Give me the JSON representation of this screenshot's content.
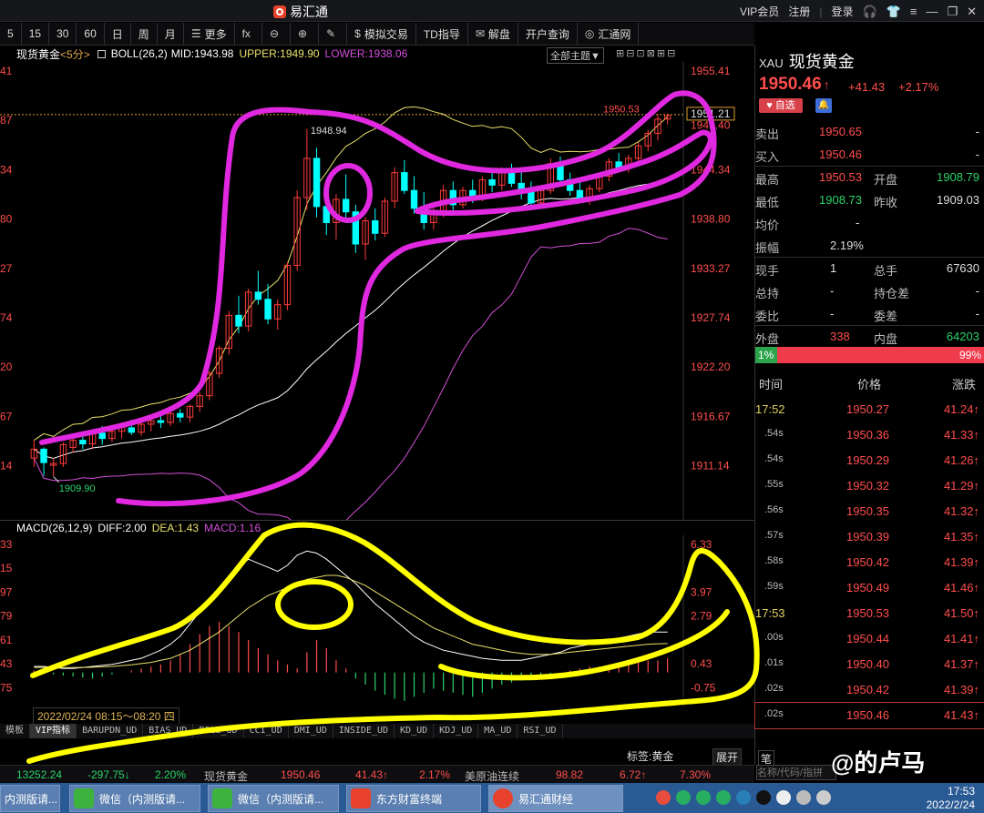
{
  "window": {
    "title": "易汇通",
    "right_links": [
      "VIP会员",
      "注册",
      "登录"
    ]
  },
  "toolbar": {
    "items": [
      {
        "label": "5"
      },
      {
        "label": "15"
      },
      {
        "label": "30"
      },
      {
        "label": "60"
      },
      {
        "label": "日"
      },
      {
        "label": "周"
      },
      {
        "label": "月"
      },
      {
        "label": "更多",
        "icon": "☰"
      },
      {
        "label": "",
        "icon": "fx"
      },
      {
        "label": "",
        "icon": "⊖"
      },
      {
        "label": "",
        "icon": "⊕"
      },
      {
        "label": "",
        "icon": "✎"
      },
      {
        "label": "模拟交易",
        "icon": "$"
      },
      {
        "label": "TD指导"
      },
      {
        "label": "解盘",
        "icon": "✉"
      },
      {
        "label": "开户查询"
      },
      {
        "label": "汇通网",
        "icon": "◎"
      }
    ]
  },
  "chart": {
    "symbol_label": "现货黄金",
    "period": "<5分>",
    "boll_label": "BOLL(26,2)",
    "mid": "MID:1943.98",
    "upper": "UPPER:1949.90",
    "lower": "LOWER:1938.06",
    "theme_select": "全部主题▼",
    "left_ticks": [
      "41",
      "87",
      "34",
      "80",
      "27",
      "74",
      "20",
      "67",
      "14"
    ],
    "right_ticks": [
      "1955.41",
      "1938.80",
      "1933.27",
      "1927.74",
      "1922.20",
      "1916.67",
      "1911.14"
    ],
    "current_tag": "1951.21",
    "high_label": "1950.53",
    "peak_label": "1948.94",
    "low_label": "1909.90",
    "price_tick_1944": "1944.34",
    "price_tick_1949": "1949.40"
  },
  "chart_data": {
    "type": "candlestick",
    "title": "现货黄金 5分",
    "ylim": [
      1906.0,
      1956.0
    ],
    "candles": [
      [
        1912.0,
        1914.0,
        1911.0,
        1913.0
      ],
      [
        1913.0,
        1913.2,
        1910.0,
        1911.5
      ],
      [
        1911.2,
        1912.0,
        1909.9,
        1911.4
      ],
      [
        1911.4,
        1913.8,
        1911.0,
        1913.5
      ],
      [
        1913.2,
        1914.4,
        1912.6,
        1914.0
      ],
      [
        1914.0,
        1914.6,
        1913.0,
        1913.6
      ],
      [
        1913.6,
        1915.2,
        1913.0,
        1915.0
      ],
      [
        1914.8,
        1915.6,
        1913.5,
        1914.2
      ],
      [
        1914.2,
        1915.4,
        1913.8,
        1915.0
      ],
      [
        1915.0,
        1916.0,
        1914.2,
        1915.6
      ],
      [
        1915.4,
        1916.3,
        1914.6,
        1914.9
      ],
      [
        1914.9,
        1916.0,
        1914.5,
        1915.8
      ],
      [
        1915.8,
        1916.6,
        1915.0,
        1916.2
      ],
      [
        1916.2,
        1917.0,
        1915.4,
        1916.0
      ],
      [
        1916.0,
        1917.2,
        1915.6,
        1917.0
      ],
      [
        1917.0,
        1917.5,
        1916.0,
        1916.6
      ],
      [
        1916.6,
        1918.0,
        1916.0,
        1917.8
      ],
      [
        1917.8,
        1919.4,
        1917.2,
        1919.0
      ],
      [
        1919.0,
        1921.8,
        1918.5,
        1921.5
      ],
      [
        1921.5,
        1924.6,
        1921.0,
        1924.3
      ],
      [
        1924.3,
        1928.5,
        1923.6,
        1928.0
      ],
      [
        1928.0,
        1930.2,
        1926.0,
        1926.8
      ],
      [
        1926.8,
        1931.0,
        1926.2,
        1930.6
      ],
      [
        1930.6,
        1933.0,
        1929.2,
        1929.8
      ],
      [
        1929.8,
        1931.5,
        1927.0,
        1927.6
      ],
      [
        1927.6,
        1929.8,
        1926.4,
        1929.2
      ],
      [
        1929.2,
        1934.0,
        1928.6,
        1933.6
      ],
      [
        1933.6,
        1942.0,
        1933.0,
        1941.2
      ],
      [
        1941.2,
        1948.9,
        1939.8,
        1945.6
      ],
      [
        1945.6,
        1946.8,
        1939.0,
        1940.2
      ],
      [
        1940.2,
        1942.6,
        1937.0,
        1938.4
      ],
      [
        1938.4,
        1941.6,
        1936.5,
        1941.0
      ],
      [
        1941.0,
        1943.8,
        1938.6,
        1939.6
      ],
      [
        1939.6,
        1940.4,
        1935.0,
        1936.0
      ],
      [
        1936.0,
        1939.0,
        1934.2,
        1938.6
      ],
      [
        1938.6,
        1940.0,
        1936.4,
        1937.2
      ],
      [
        1937.2,
        1941.2,
        1936.8,
        1940.8
      ],
      [
        1940.8,
        1944.6,
        1940.0,
        1944.0
      ],
      [
        1944.0,
        1945.4,
        1941.6,
        1942.0
      ],
      [
        1942.0,
        1943.6,
        1939.4,
        1940.0
      ],
      [
        1940.0,
        1941.8,
        1937.6,
        1938.4
      ],
      [
        1938.4,
        1940.0,
        1937.6,
        1939.6
      ],
      [
        1939.6,
        1942.6,
        1939.0,
        1942.0
      ],
      [
        1942.0,
        1943.0,
        1939.6,
        1940.4
      ],
      [
        1940.4,
        1942.4,
        1940.0,
        1942.0
      ],
      [
        1942.0,
        1943.2,
        1940.6,
        1941.2
      ],
      [
        1941.2,
        1943.6,
        1940.8,
        1943.2
      ],
      [
        1943.2,
        1944.2,
        1941.8,
        1942.6
      ],
      [
        1942.6,
        1944.6,
        1942.0,
        1944.0
      ],
      [
        1944.0,
        1945.0,
        1942.4,
        1942.8
      ],
      [
        1942.8,
        1944.0,
        1941.0,
        1941.8
      ],
      [
        1941.8,
        1943.0,
        1940.2,
        1940.6
      ],
      [
        1940.6,
        1942.4,
        1940.0,
        1942.0
      ],
      [
        1942.0,
        1945.6,
        1941.6,
        1945.0
      ],
      [
        1945.0,
        1945.8,
        1942.8,
        1943.2
      ],
      [
        1943.2,
        1944.0,
        1941.4,
        1942.0
      ],
      [
        1942.0,
        1943.2,
        1940.6,
        1941.0
      ],
      [
        1941.0,
        1942.6,
        1940.4,
        1942.2
      ],
      [
        1942.2,
        1944.0,
        1941.8,
        1943.6
      ],
      [
        1943.6,
        1945.6,
        1943.0,
        1945.2
      ],
      [
        1945.2,
        1946.2,
        1944.2,
        1944.6
      ],
      [
        1944.6,
        1946.0,
        1944.0,
        1945.6
      ],
      [
        1945.6,
        1947.4,
        1945.0,
        1947.0
      ],
      [
        1947.0,
        1948.8,
        1946.4,
        1948.4
      ],
      [
        1948.4,
        1950.53,
        1947.6,
        1950.0
      ],
      [
        1950.0,
        1950.6,
        1949.4,
        1950.4
      ]
    ],
    "macd": {
      "label": "MACD(26,12,9)",
      "diff": "DIFF:2.00",
      "dea": "DEA:1.43",
      "macd": "MACD:1.16",
      "right_ticks": [
        "6.33",
        "3.97",
        "2.79",
        "0.43",
        "-0.75"
      ],
      "left_ticks": [
        "33",
        "15",
        "97",
        "79",
        "61",
        "43",
        "75"
      ],
      "ylim": [
        -1.5,
        6.6
      ],
      "hist": [
        0.1,
        0.05,
        -0.1,
        -0.15,
        -0.2,
        -0.25,
        -0.3,
        -0.2,
        -0.1,
        0,
        0.1,
        0.2,
        0.3,
        0.4,
        0.6,
        0.9,
        1.4,
        1.9,
        2.3,
        2.5,
        2.3,
        2.0,
        1.6,
        1.2,
        0.9,
        0.6,
        0.4,
        0.2,
        1.0,
        1.6,
        1.2,
        0.6,
        0.2,
        -0.3,
        -0.6,
        -0.9,
        -1.1,
        -1.3,
        -1.4,
        -1.2,
        -1.0,
        -0.8,
        -0.9,
        -1.0,
        -1.1,
        -1.2,
        -1.0,
        -0.8,
        -0.6,
        -0.5,
        -0.4,
        -0.3,
        -0.2,
        -0.1,
        0,
        0.1,
        0.2,
        0.3,
        0.3,
        0.4,
        0.4,
        0.5,
        0.5,
        0.6,
        0.6,
        0.7
      ],
      "diff_line": [
        0.3,
        0.3,
        0.25,
        0.2,
        0.2,
        0.25,
        0.3,
        0.35,
        0.4,
        0.5,
        0.6,
        0.7,
        0.9,
        1.1,
        1.4,
        1.8,
        2.4,
        3.0,
        3.6,
        4.2,
        4.7,
        5.2,
        5.6,
        5.4,
        5.2,
        5.0,
        5.3,
        5.8,
        6.0,
        5.9,
        5.6,
        5.2,
        4.8,
        4.4,
        3.9,
        3.4,
        3.0,
        2.6,
        2.2,
        1.8,
        1.5,
        1.3,
        1.1,
        1.0,
        0.9,
        0.8,
        0.7,
        0.65,
        0.6,
        0.6,
        0.6,
        0.7,
        0.8,
        0.9,
        1.0,
        1.2,
        1.3,
        1.4,
        1.5,
        1.6,
        1.7,
        1.8,
        1.9,
        2.0,
        2.0,
        2.0
      ],
      "dea_line": [
        0.25,
        0.25,
        0.25,
        0.24,
        0.24,
        0.25,
        0.26,
        0.28,
        0.3,
        0.34,
        0.38,
        0.44,
        0.5,
        0.6,
        0.7,
        0.9,
        1.1,
        1.4,
        1.7,
        2.0,
        2.4,
        2.8,
        3.2,
        3.5,
        3.8,
        4.0,
        4.2,
        4.4,
        4.6,
        4.7,
        4.8,
        4.8,
        4.7,
        4.5,
        4.3,
        4.0,
        3.7,
        3.4,
        3.1,
        2.8,
        2.5,
        2.2,
        2.0,
        1.8,
        1.6,
        1.4,
        1.3,
        1.2,
        1.1,
        1.0,
        0.95,
        0.9,
        0.9,
        0.9,
        0.95,
        1.0,
        1.05,
        1.1,
        1.15,
        1.2,
        1.25,
        1.3,
        1.35,
        1.4,
        1.42,
        1.43
      ]
    }
  },
  "quote": {
    "code": "XAU",
    "name": "现货黄金",
    "price": "1950.46",
    "price_arrow": "↑",
    "change": "+41.43",
    "change_pct": "+2.17%",
    "fav_label": "♥ 自选",
    "rows": [
      {
        "k": "卖出",
        "v": "1950.65",
        "k2": "",
        "v2": "-"
      },
      {
        "k": "买入",
        "v": "1950.46",
        "k2": "",
        "v2": "-"
      },
      {
        "k": "最高",
        "v": "1950.53",
        "k2": "开盘",
        "v2": "1908.79"
      },
      {
        "k": "最低",
        "v": "1908.73",
        "k2": "昨收",
        "v2": "1909.03"
      },
      {
        "k": "均价",
        "v": "-",
        "k2": "",
        "v2": ""
      },
      {
        "k": "振幅",
        "v": "2.19%",
        "k2": "",
        "v2": ""
      },
      {
        "k": "现手",
        "v": "1",
        "k2": "总手",
        "v2": "67630"
      },
      {
        "k": "总持",
        "v": "-",
        "k2": "持仓差",
        "v2": "-"
      },
      {
        "k": "委比",
        "v": "-",
        "k2": "委差",
        "v2": "-"
      },
      {
        "k": "外盘",
        "v": "338",
        "k2": "内盘",
        "v2": "64203"
      }
    ],
    "buy_ratio": 0.01,
    "buy_label": "1%",
    "sell_label": "99%",
    "tick_header": [
      "时间",
      "价格",
      "涨跌"
    ],
    "ticks": [
      {
        "t": "17:52",
        "p": "1950.27",
        "c": "41.24↑"
      },
      {
        "t": ".54s",
        "p": "1950.36",
        "c": "41.33↑"
      },
      {
        "t": ".54s",
        "p": "1950.29",
        "c": "41.26↑"
      },
      {
        "t": ".55s",
        "p": "1950.32",
        "c": "41.29↑"
      },
      {
        "t": ".56s",
        "p": "1950.35",
        "c": "41.32↑"
      },
      {
        "t": ".57s",
        "p": "1950.39",
        "c": "41.35↑"
      },
      {
        "t": ".58s",
        "p": "1950.42",
        "c": "41.39↑"
      },
      {
        "t": ".59s",
        "p": "1950.49",
        "c": "41.46↑"
      },
      {
        "t": "17:53",
        "p": "1950.53",
        "c": "41.50↑"
      },
      {
        "t": ".00s",
        "p": "1950.44",
        "c": "41.41↑"
      },
      {
        "t": ".01s",
        "p": "1950.40",
        "c": "41.37↑"
      },
      {
        "t": ".02s",
        "p": "1950.42",
        "c": "41.39↑"
      },
      {
        "t": ".02s",
        "p": "1950.46",
        "c": "41.43↑"
      }
    ],
    "search_placeholder": "名称/代码/指拼",
    "search_label": "笔"
  },
  "bottom": {
    "date_range": "2022/02/24 08:15～08:20 四",
    "indicator_tabs": [
      "模板",
      "VIP指标",
      "BARUPDN_UD",
      "BIAS_UD",
      "BOLL_UD",
      "CCI_UD",
      "DMI_UD",
      "INSIDE_UD",
      "KD_UD",
      "KDJ_UD",
      "MA_UD",
      "RSI_UD"
    ],
    "tag_label": "标签:黄金",
    "expand_label": "展开",
    "status": [
      "13252.24",
      "-297.75↓",
      "2.20%",
      "现货黄金",
      "1950.46",
      "41.43↑",
      "2.17%",
      "美原油连续",
      "98.82",
      "6.72↑",
      "7.30%"
    ]
  },
  "taskbar": {
    "tasks": [
      "内测版请...",
      "微信（内测版请...",
      "微信（内测版请...",
      "东方财富终端",
      "易汇通财经"
    ],
    "time": "17:53",
    "date": "2022/2/24"
  },
  "watermark": "@的卢马",
  "colors": {
    "up": "#ff3b3b",
    "down": "#00ffff",
    "upper_band": "#e8e06a",
    "mid_band": "#ffffff",
    "lower_band": "#d14fd8",
    "annotation_magenta": "#e028e0",
    "annotation_yellow": "#ffff00"
  }
}
